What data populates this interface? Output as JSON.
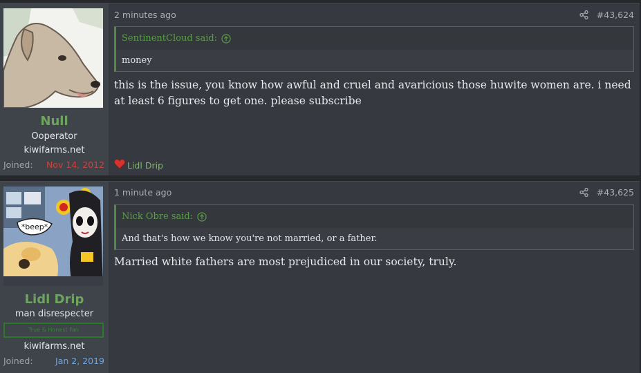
{
  "posts": [
    {
      "user": {
        "name": "Null",
        "title": "Ooperator",
        "site": "kiwifarms.net",
        "joined_label": "Joined:",
        "joined_date": "Nov 14, 2012",
        "joined_color": "#c9453d"
      },
      "time": "2 minutes ago",
      "post_number": "#43,624",
      "quote": {
        "author": "SentinentCloud said:",
        "text": "money"
      },
      "message": "this is the issue, you know how awful and cruel and avaricious those huwite women are. i need at least 6 figures to get one. please subscribe",
      "reaction": {
        "icon": "heart-icon",
        "user": "Lidl Drip"
      }
    },
    {
      "user": {
        "name": "Lidl Drip",
        "title": "man disrespecter",
        "banner": "True & Honest Fan",
        "site": "kiwifarms.net",
        "joined_label": "Joined:",
        "joined_date": "Jan 2, 2019",
        "joined_color": "#6ea7e0"
      },
      "time": "1 minute ago",
      "post_number": "#43,625",
      "quote": {
        "author": "Nick Obre said:",
        "text": "And that's how we know you're not married, or a father."
      },
      "message": "Married white fathers are most prejudiced in our society, truly.",
      "avatar_text": "*beep*"
    }
  ],
  "colors": {
    "username": "#6ea55e",
    "accent_green": "#4f8c42"
  }
}
